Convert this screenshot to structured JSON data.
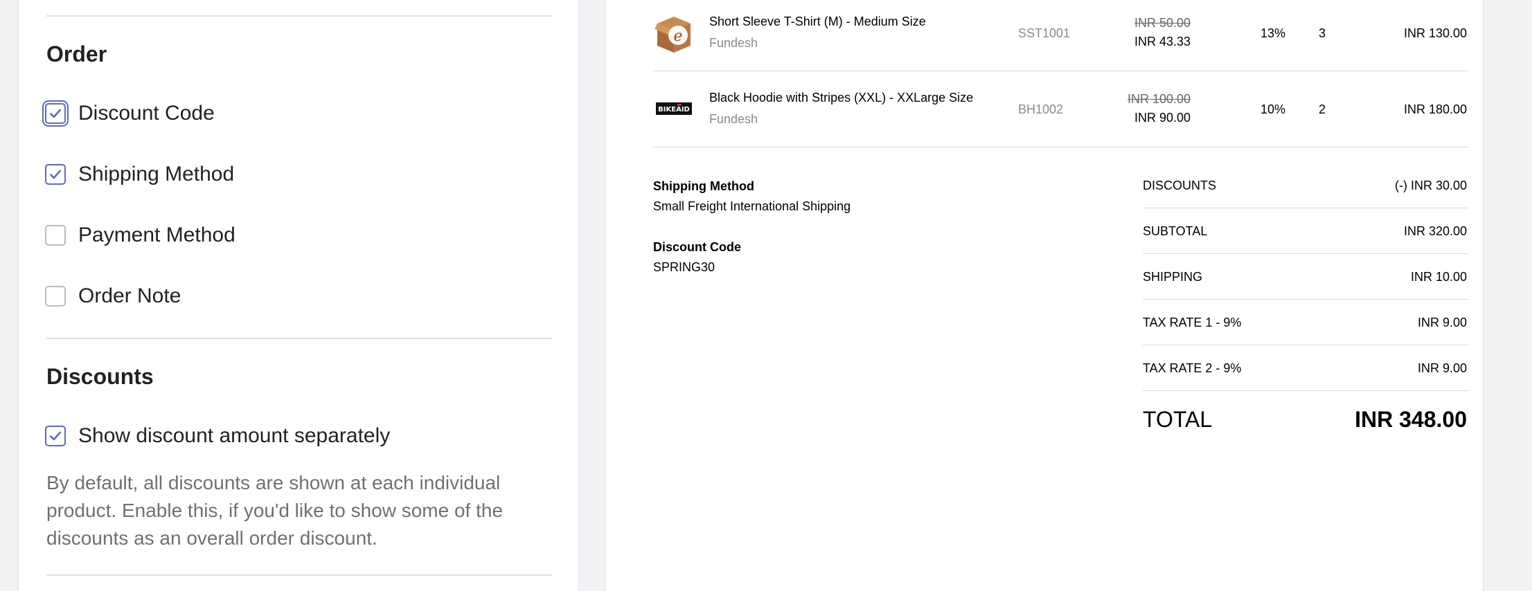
{
  "settings": {
    "order": {
      "title": "Order",
      "options": [
        {
          "label": "Discount Code",
          "checked": true
        },
        {
          "label": "Shipping Method",
          "checked": true
        },
        {
          "label": "Payment Method",
          "checked": false
        },
        {
          "label": "Order Note",
          "checked": false
        }
      ]
    },
    "discounts": {
      "title": "Discounts",
      "option": {
        "label": "Show discount amount separately",
        "checked": true
      },
      "help": "By default, all discounts are shown at each individual product. Enable this, if you'd like to show some of the discounts as an overall order discount."
    },
    "accent_color": "#5c6ac4"
  },
  "invoice": {
    "items": [
      {
        "name": "Short Sleeve T-Shirt (M) - Medium Size",
        "vendor": "Fundesh",
        "sku": "SST1001",
        "original_price": "INR 50.00",
        "price": "INR 43.33",
        "tax": "13%",
        "qty": "3",
        "total": "INR 130.00",
        "thumbnail_icon": "cardboard-box-logo-icon"
      },
      {
        "name": "Black Hoodie with Stripes (XXL) - XXLarge Size",
        "vendor": "Fundesh",
        "sku": "BH1002",
        "original_price": "INR 100.00",
        "price": "INR 90.00",
        "tax": "10%",
        "qty": "2",
        "total": "INR 180.00",
        "thumbnail_icon": "bikeaid-logo-icon"
      }
    ],
    "shipping_method": {
      "label": "Shipping Method",
      "value": "Small Freight International Shipping"
    },
    "discount_code": {
      "label": "Discount Code",
      "value": "SPRING30"
    },
    "summary": [
      {
        "label": "DISCOUNTS",
        "value": "(-) INR 30.00"
      },
      {
        "label": "SUBTOTAL",
        "value": "INR 320.00"
      },
      {
        "label": "SHIPPING",
        "value": "INR 10.00"
      },
      {
        "label": "TAX RATE 1 - 9%",
        "value": "INR 9.00"
      },
      {
        "label": "TAX RATE 2 - 9%",
        "value": "INR 9.00"
      }
    ],
    "total": {
      "label": "TOTAL",
      "value": "INR 348.00"
    }
  }
}
